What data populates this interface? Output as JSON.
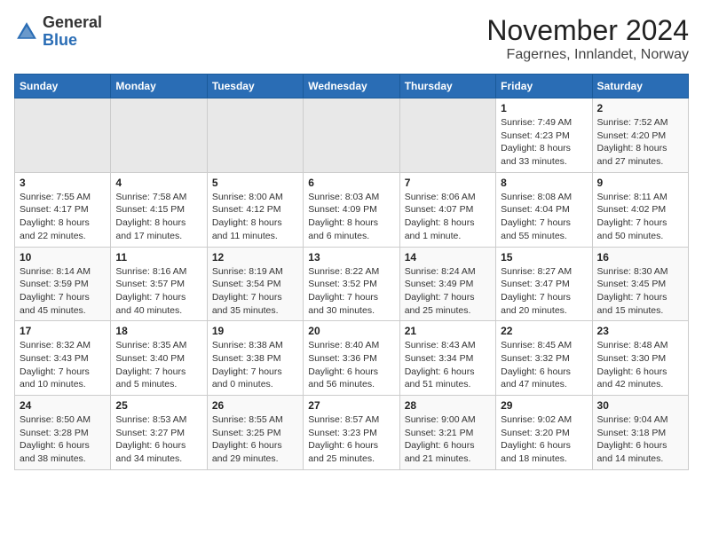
{
  "header": {
    "logo": {
      "general": "General",
      "blue": "Blue"
    },
    "title": "November 2024",
    "subtitle": "Fagernes, Innlandet, Norway"
  },
  "weekdays": [
    "Sunday",
    "Monday",
    "Tuesday",
    "Wednesday",
    "Thursday",
    "Friday",
    "Saturday"
  ],
  "weeks": [
    [
      {
        "day": "",
        "info": ""
      },
      {
        "day": "",
        "info": ""
      },
      {
        "day": "",
        "info": ""
      },
      {
        "day": "",
        "info": ""
      },
      {
        "day": "",
        "info": ""
      },
      {
        "day": "1",
        "info": "Sunrise: 7:49 AM\nSunset: 4:23 PM\nDaylight: 8 hours and 33 minutes."
      },
      {
        "day": "2",
        "info": "Sunrise: 7:52 AM\nSunset: 4:20 PM\nDaylight: 8 hours and 27 minutes."
      }
    ],
    [
      {
        "day": "3",
        "info": "Sunrise: 7:55 AM\nSunset: 4:17 PM\nDaylight: 8 hours and 22 minutes."
      },
      {
        "day": "4",
        "info": "Sunrise: 7:58 AM\nSunset: 4:15 PM\nDaylight: 8 hours and 17 minutes."
      },
      {
        "day": "5",
        "info": "Sunrise: 8:00 AM\nSunset: 4:12 PM\nDaylight: 8 hours and 11 minutes."
      },
      {
        "day": "6",
        "info": "Sunrise: 8:03 AM\nSunset: 4:09 PM\nDaylight: 8 hours and 6 minutes."
      },
      {
        "day": "7",
        "info": "Sunrise: 8:06 AM\nSunset: 4:07 PM\nDaylight: 8 hours and 1 minute."
      },
      {
        "day": "8",
        "info": "Sunrise: 8:08 AM\nSunset: 4:04 PM\nDaylight: 7 hours and 55 minutes."
      },
      {
        "day": "9",
        "info": "Sunrise: 8:11 AM\nSunset: 4:02 PM\nDaylight: 7 hours and 50 minutes."
      }
    ],
    [
      {
        "day": "10",
        "info": "Sunrise: 8:14 AM\nSunset: 3:59 PM\nDaylight: 7 hours and 45 minutes."
      },
      {
        "day": "11",
        "info": "Sunrise: 8:16 AM\nSunset: 3:57 PM\nDaylight: 7 hours and 40 minutes."
      },
      {
        "day": "12",
        "info": "Sunrise: 8:19 AM\nSunset: 3:54 PM\nDaylight: 7 hours and 35 minutes."
      },
      {
        "day": "13",
        "info": "Sunrise: 8:22 AM\nSunset: 3:52 PM\nDaylight: 7 hours and 30 minutes."
      },
      {
        "day": "14",
        "info": "Sunrise: 8:24 AM\nSunset: 3:49 PM\nDaylight: 7 hours and 25 minutes."
      },
      {
        "day": "15",
        "info": "Sunrise: 8:27 AM\nSunset: 3:47 PM\nDaylight: 7 hours and 20 minutes."
      },
      {
        "day": "16",
        "info": "Sunrise: 8:30 AM\nSunset: 3:45 PM\nDaylight: 7 hours and 15 minutes."
      }
    ],
    [
      {
        "day": "17",
        "info": "Sunrise: 8:32 AM\nSunset: 3:43 PM\nDaylight: 7 hours and 10 minutes."
      },
      {
        "day": "18",
        "info": "Sunrise: 8:35 AM\nSunset: 3:40 PM\nDaylight: 7 hours and 5 minutes."
      },
      {
        "day": "19",
        "info": "Sunrise: 8:38 AM\nSunset: 3:38 PM\nDaylight: 7 hours and 0 minutes."
      },
      {
        "day": "20",
        "info": "Sunrise: 8:40 AM\nSunset: 3:36 PM\nDaylight: 6 hours and 56 minutes."
      },
      {
        "day": "21",
        "info": "Sunrise: 8:43 AM\nSunset: 3:34 PM\nDaylight: 6 hours and 51 minutes."
      },
      {
        "day": "22",
        "info": "Sunrise: 8:45 AM\nSunset: 3:32 PM\nDaylight: 6 hours and 47 minutes."
      },
      {
        "day": "23",
        "info": "Sunrise: 8:48 AM\nSunset: 3:30 PM\nDaylight: 6 hours and 42 minutes."
      }
    ],
    [
      {
        "day": "24",
        "info": "Sunrise: 8:50 AM\nSunset: 3:28 PM\nDaylight: 6 hours and 38 minutes."
      },
      {
        "day": "25",
        "info": "Sunrise: 8:53 AM\nSunset: 3:27 PM\nDaylight: 6 hours and 34 minutes."
      },
      {
        "day": "26",
        "info": "Sunrise: 8:55 AM\nSunset: 3:25 PM\nDaylight: 6 hours and 29 minutes."
      },
      {
        "day": "27",
        "info": "Sunrise: 8:57 AM\nSunset: 3:23 PM\nDaylight: 6 hours and 25 minutes."
      },
      {
        "day": "28",
        "info": "Sunrise: 9:00 AM\nSunset: 3:21 PM\nDaylight: 6 hours and 21 minutes."
      },
      {
        "day": "29",
        "info": "Sunrise: 9:02 AM\nSunset: 3:20 PM\nDaylight: 6 hours and 18 minutes."
      },
      {
        "day": "30",
        "info": "Sunrise: 9:04 AM\nSunset: 3:18 PM\nDaylight: 6 hours and 14 minutes."
      }
    ]
  ]
}
